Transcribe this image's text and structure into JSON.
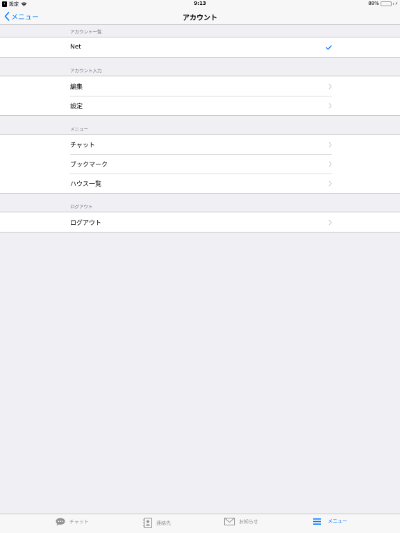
{
  "status": {
    "left": "設定",
    "time": "9:13",
    "battery": "88%",
    "battery_level": 0.88
  },
  "nav": {
    "back_label": "メニュー",
    "title": "アカウント"
  },
  "sections": [
    {
      "header": "アカウント一覧",
      "items": [
        {
          "label": "Net",
          "accessory": "checkmark"
        }
      ]
    },
    {
      "header": "アカウント入力",
      "items": [
        {
          "label": "編集",
          "accessory": "chevron"
        },
        {
          "label": "設定",
          "accessory": "chevron"
        }
      ]
    },
    {
      "header": "メニュー",
      "items": [
        {
          "label": "チャット",
          "accessory": "chevron"
        },
        {
          "label": "ブックマーク",
          "accessory": "chevron"
        },
        {
          "label": "ハウス一覧",
          "accessory": "chevron"
        }
      ]
    },
    {
      "header": "ログアウト",
      "items": [
        {
          "label": "ログアウト",
          "accessory": "chevron"
        }
      ]
    }
  ],
  "tabs": [
    {
      "label": "チャット",
      "icon": "chat-icon",
      "active": false
    },
    {
      "label": "連絡先",
      "icon": "contacts-icon",
      "active": false
    },
    {
      "label": "お知らせ",
      "icon": "mail-icon",
      "active": false
    },
    {
      "label": "メニュー",
      "icon": "menu-icon",
      "active": true
    }
  ],
  "colors": {
    "accent": "#007aff",
    "background": "#efeff4",
    "inactive_tab": "#929292",
    "battery": "#4cd964"
  }
}
